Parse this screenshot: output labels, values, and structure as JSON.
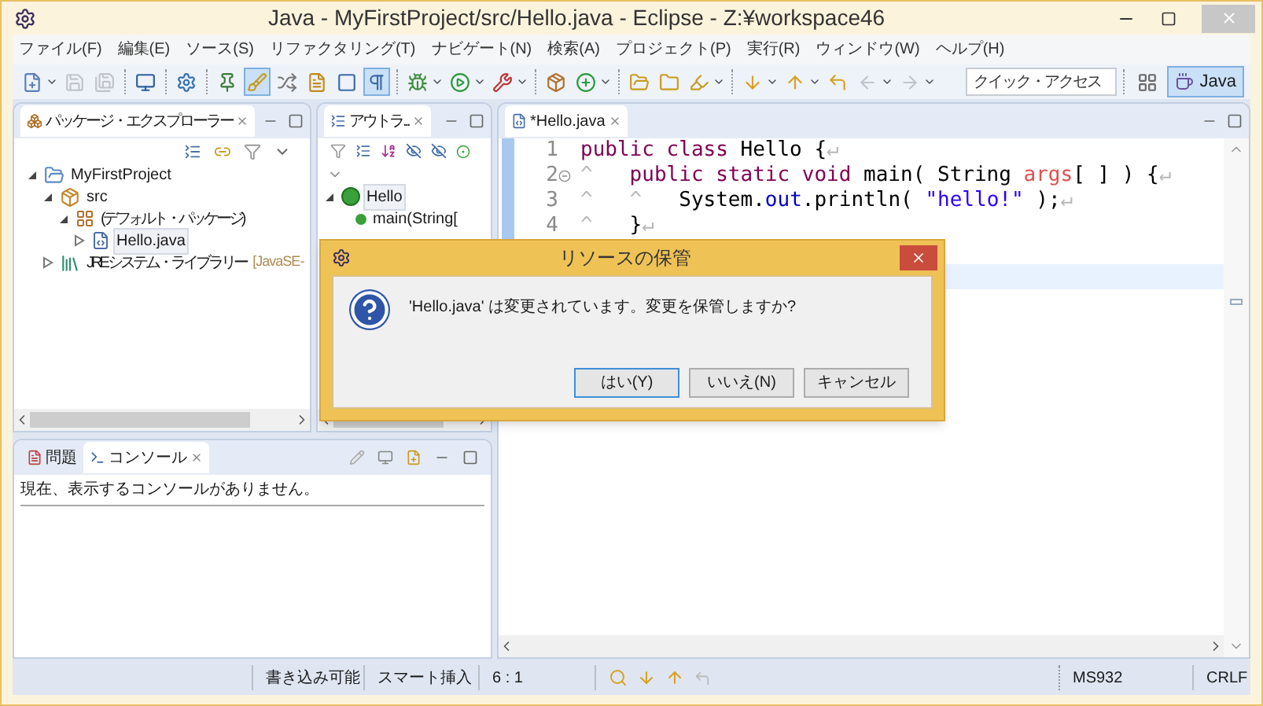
{
  "window": {
    "title": "Java - MyFirstProject/src/Hello.java - Eclipse - Z:¥workspace46"
  },
  "menu": [
    "ファイル(F)",
    "編集(E)",
    "ソース(S)",
    "リファクタリング(T)",
    "ナビゲート(N)",
    "検索(A)",
    "プロジェクト(P)",
    "実行(R)",
    "ウィンドウ(W)",
    "ヘルプ(H)"
  ],
  "toolbar": [
    {
      "kind": "dropdown",
      "pressed": false,
      "disabled": false
    },
    {
      "kind": "button",
      "pressed": false,
      "disabled": true
    },
    {
      "kind": "button",
      "pressed": false,
      "disabled": true
    },
    {
      "kind": "separator"
    },
    {
      "kind": "button",
      "pressed": false,
      "disabled": false
    },
    {
      "kind": "separator"
    },
    {
      "kind": "button",
      "pressed": false,
      "disabled": false
    },
    {
      "kind": "separator"
    },
    {
      "kind": "button",
      "pressed": false,
      "disabled": false
    },
    {
      "kind": "button",
      "pressed": true,
      "disabled": false
    },
    {
      "kind": "button",
      "pressed": false,
      "disabled": false
    },
    {
      "kind": "button",
      "pressed": false,
      "disabled": false
    },
    {
      "kind": "button",
      "pressed": false,
      "disabled": false
    },
    {
      "kind": "button",
      "pressed": true,
      "disabled": false
    },
    {
      "kind": "separator"
    },
    {
      "kind": "dropdown",
      "pressed": false,
      "disabled": false
    },
    {
      "kind": "dropdown",
      "pressed": false,
      "disabled": false
    },
    {
      "kind": "dropdown",
      "pressed": false,
      "disabled": false
    },
    {
      "kind": "separator"
    },
    {
      "kind": "button",
      "pressed": false,
      "disabled": false
    },
    {
      "kind": "dropdown",
      "pressed": false,
      "disabled": false
    },
    {
      "kind": "separator"
    },
    {
      "kind": "button",
      "pressed": false,
      "disabled": false
    },
    {
      "kind": "button",
      "pressed": false,
      "disabled": false
    },
    {
      "kind": "dropdown",
      "pressed": false,
      "disabled": false
    },
    {
      "kind": "separator"
    },
    {
      "kind": "dropdown",
      "pressed": false,
      "disabled": false
    },
    {
      "kind": "dropdown",
      "pressed": false,
      "disabled": false
    },
    {
      "kind": "button",
      "pressed": false,
      "disabled": false
    },
    {
      "kind": "dropdown",
      "pressed": false,
      "disabled": true
    },
    {
      "kind": "dropdown",
      "pressed": false,
      "disabled": true
    }
  ],
  "quick_access": {
    "placeholder": "クイック・アクセス"
  },
  "perspective": {
    "label": "Java",
    "selected": true
  },
  "package_explorer": {
    "tab": "パッケージ・エクスプローラー",
    "tree": [
      {
        "label": "MyFirstProject",
        "kind": "project",
        "expanded": true,
        "selected": false,
        "children": [
          {
            "label": "src",
            "kind": "folder",
            "expanded": true,
            "selected": false,
            "children": [
              {
                "label": "(デフォルト・パッケージ)",
                "kind": "package",
                "expanded": true,
                "selected": false,
                "children": [
                  {
                    "label": "Hello.java",
                    "kind": "file",
                    "expanded": false,
                    "selected": true
                  }
                ]
              }
            ]
          },
          {
            "label": "JRE システム・ライブラリー",
            "suffix": "[JavaSE-",
            "kind": "library",
            "expanded": false,
            "selected": false
          }
        ]
      }
    ]
  },
  "outline": {
    "tab": "アウトラ...",
    "tree": [
      {
        "label": "Hello",
        "kind": "class",
        "expanded": true,
        "selected": true,
        "children": [
          {
            "label": "main(String[",
            "kind": "method",
            "selected": false
          }
        ]
      }
    ]
  },
  "editor": {
    "tab": "*Hello.java",
    "lines": [
      {
        "number": "1",
        "changed": true,
        "current": false,
        "tokens": [
          {
            "text": "public class",
            "kind": "keyword"
          },
          {
            "text": " Hello {",
            "kind": "plain"
          },
          {
            "text": "↵",
            "kind": "whitespace"
          }
        ]
      },
      {
        "number": "2",
        "changed": true,
        "current": false,
        "foldable": true,
        "tokens": [
          {
            "text": "^",
            "kind": "whitespace"
          },
          {
            "text": "   public static void",
            "kind": "keyword"
          },
          {
            "text": " main( String ",
            "kind": "plain"
          },
          {
            "text": "args",
            "kind": "parameter"
          },
          {
            "text": "[ ] ) {",
            "kind": "plain"
          },
          {
            "text": "↵",
            "kind": "whitespace"
          }
        ]
      },
      {
        "number": "3",
        "changed": true,
        "current": false,
        "tokens": [
          {
            "text": "^   ^",
            "kind": "whitespace"
          },
          {
            "text": "   System.",
            "kind": "plain"
          },
          {
            "text": "out",
            "kind": "field"
          },
          {
            "text": ".println( ",
            "kind": "plain"
          },
          {
            "text": "\"hello!\"",
            "kind": "string"
          },
          {
            "text": " );",
            "kind": "plain"
          },
          {
            "text": "↵",
            "kind": "whitespace"
          }
        ]
      },
      {
        "number": "4",
        "changed": true,
        "current": false,
        "tokens": [
          {
            "text": "^",
            "kind": "whitespace"
          },
          {
            "text": "   }",
            "kind": "plain"
          },
          {
            "text": "↵",
            "kind": "whitespace"
          }
        ]
      },
      {
        "current": false
      },
      {
        "current": true
      }
    ]
  },
  "bottom_panel": {
    "tabs": [
      {
        "label": "問題",
        "selected": false
      },
      {
        "label": "コンソール",
        "selected": true
      }
    ],
    "message": "現在、表示するコンソールがありません。"
  },
  "status_bar": {
    "writable": "書き込み可能",
    "insert_mode": "スマート挿入",
    "position": "6 : 1",
    "encoding": "MS932",
    "line_delimiter": "CRLF"
  },
  "dialog": {
    "title": "リソースの保管",
    "message": "'Hello.java' は変更されています。変更を保管しますか?",
    "buttons": [
      {
        "label": "はい(Y)",
        "default": true
      },
      {
        "label": "いいえ(N)",
        "default": false
      },
      {
        "label": "キャンセル",
        "default": false
      }
    ]
  }
}
